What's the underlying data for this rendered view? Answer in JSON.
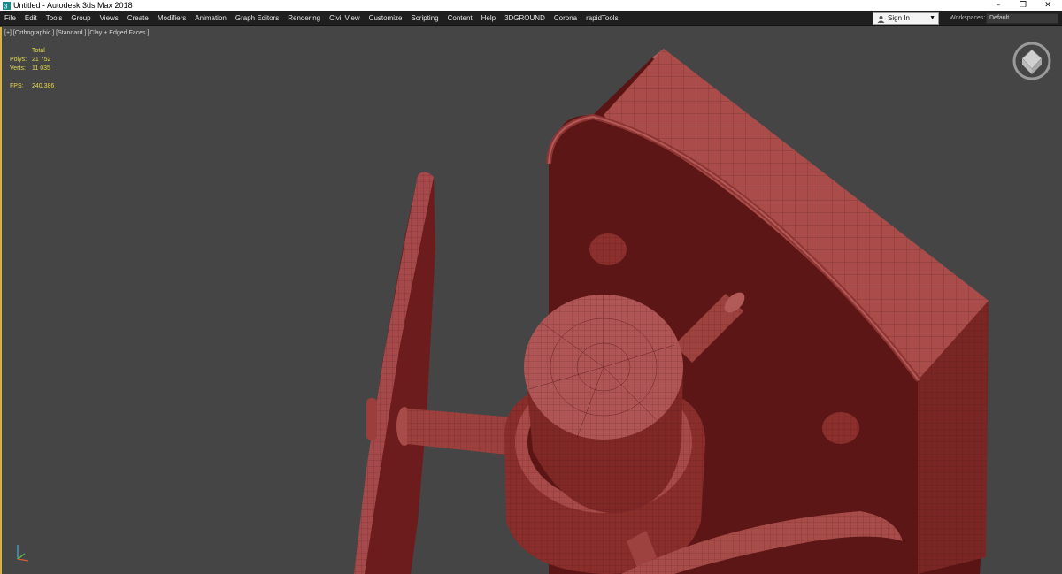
{
  "window": {
    "title": "Untitled - Autodesk 3ds Max 2018",
    "minimize_glyph": "–",
    "restore_glyph": "❐",
    "close_glyph": "✕"
  },
  "menu": {
    "items": [
      "File",
      "Edit",
      "Tools",
      "Group",
      "Views",
      "Create",
      "Modifiers",
      "Animation",
      "Graph Editors",
      "Rendering",
      "Civil View",
      "Customize",
      "Scripting",
      "Content",
      "Help",
      "3DGROUND",
      "Corona",
      "rapidTools"
    ]
  },
  "account": {
    "sign_in_label": "Sign In",
    "workspaces_label": "Workspaces:",
    "workspace_value": "Default"
  },
  "viewport": {
    "label": "[+] [Orthographic ] [Standard ] [Clay + Edged Faces ]",
    "stats": {
      "header": "Total",
      "polys_label": "Polys:",
      "polys_value": "21 752",
      "verts_label": "Verts:",
      "verts_value": "11 035",
      "fps_label": "FPS:",
      "fps_value": "240,386"
    }
  },
  "colors": {
    "title_bg": "#ffffff",
    "menubar_bg": "#1f1f1f",
    "viewport_bg": "#454545",
    "model_dark": "#5a1414",
    "model_mid": "#8a2e2c",
    "model_light": "#b05555",
    "stats_text": "#e4d94a",
    "active_border": "#d4b44a"
  },
  "icons": [
    "app-icon",
    "user-icon",
    "viewcube-icon",
    "axis-tripod-icon"
  ]
}
